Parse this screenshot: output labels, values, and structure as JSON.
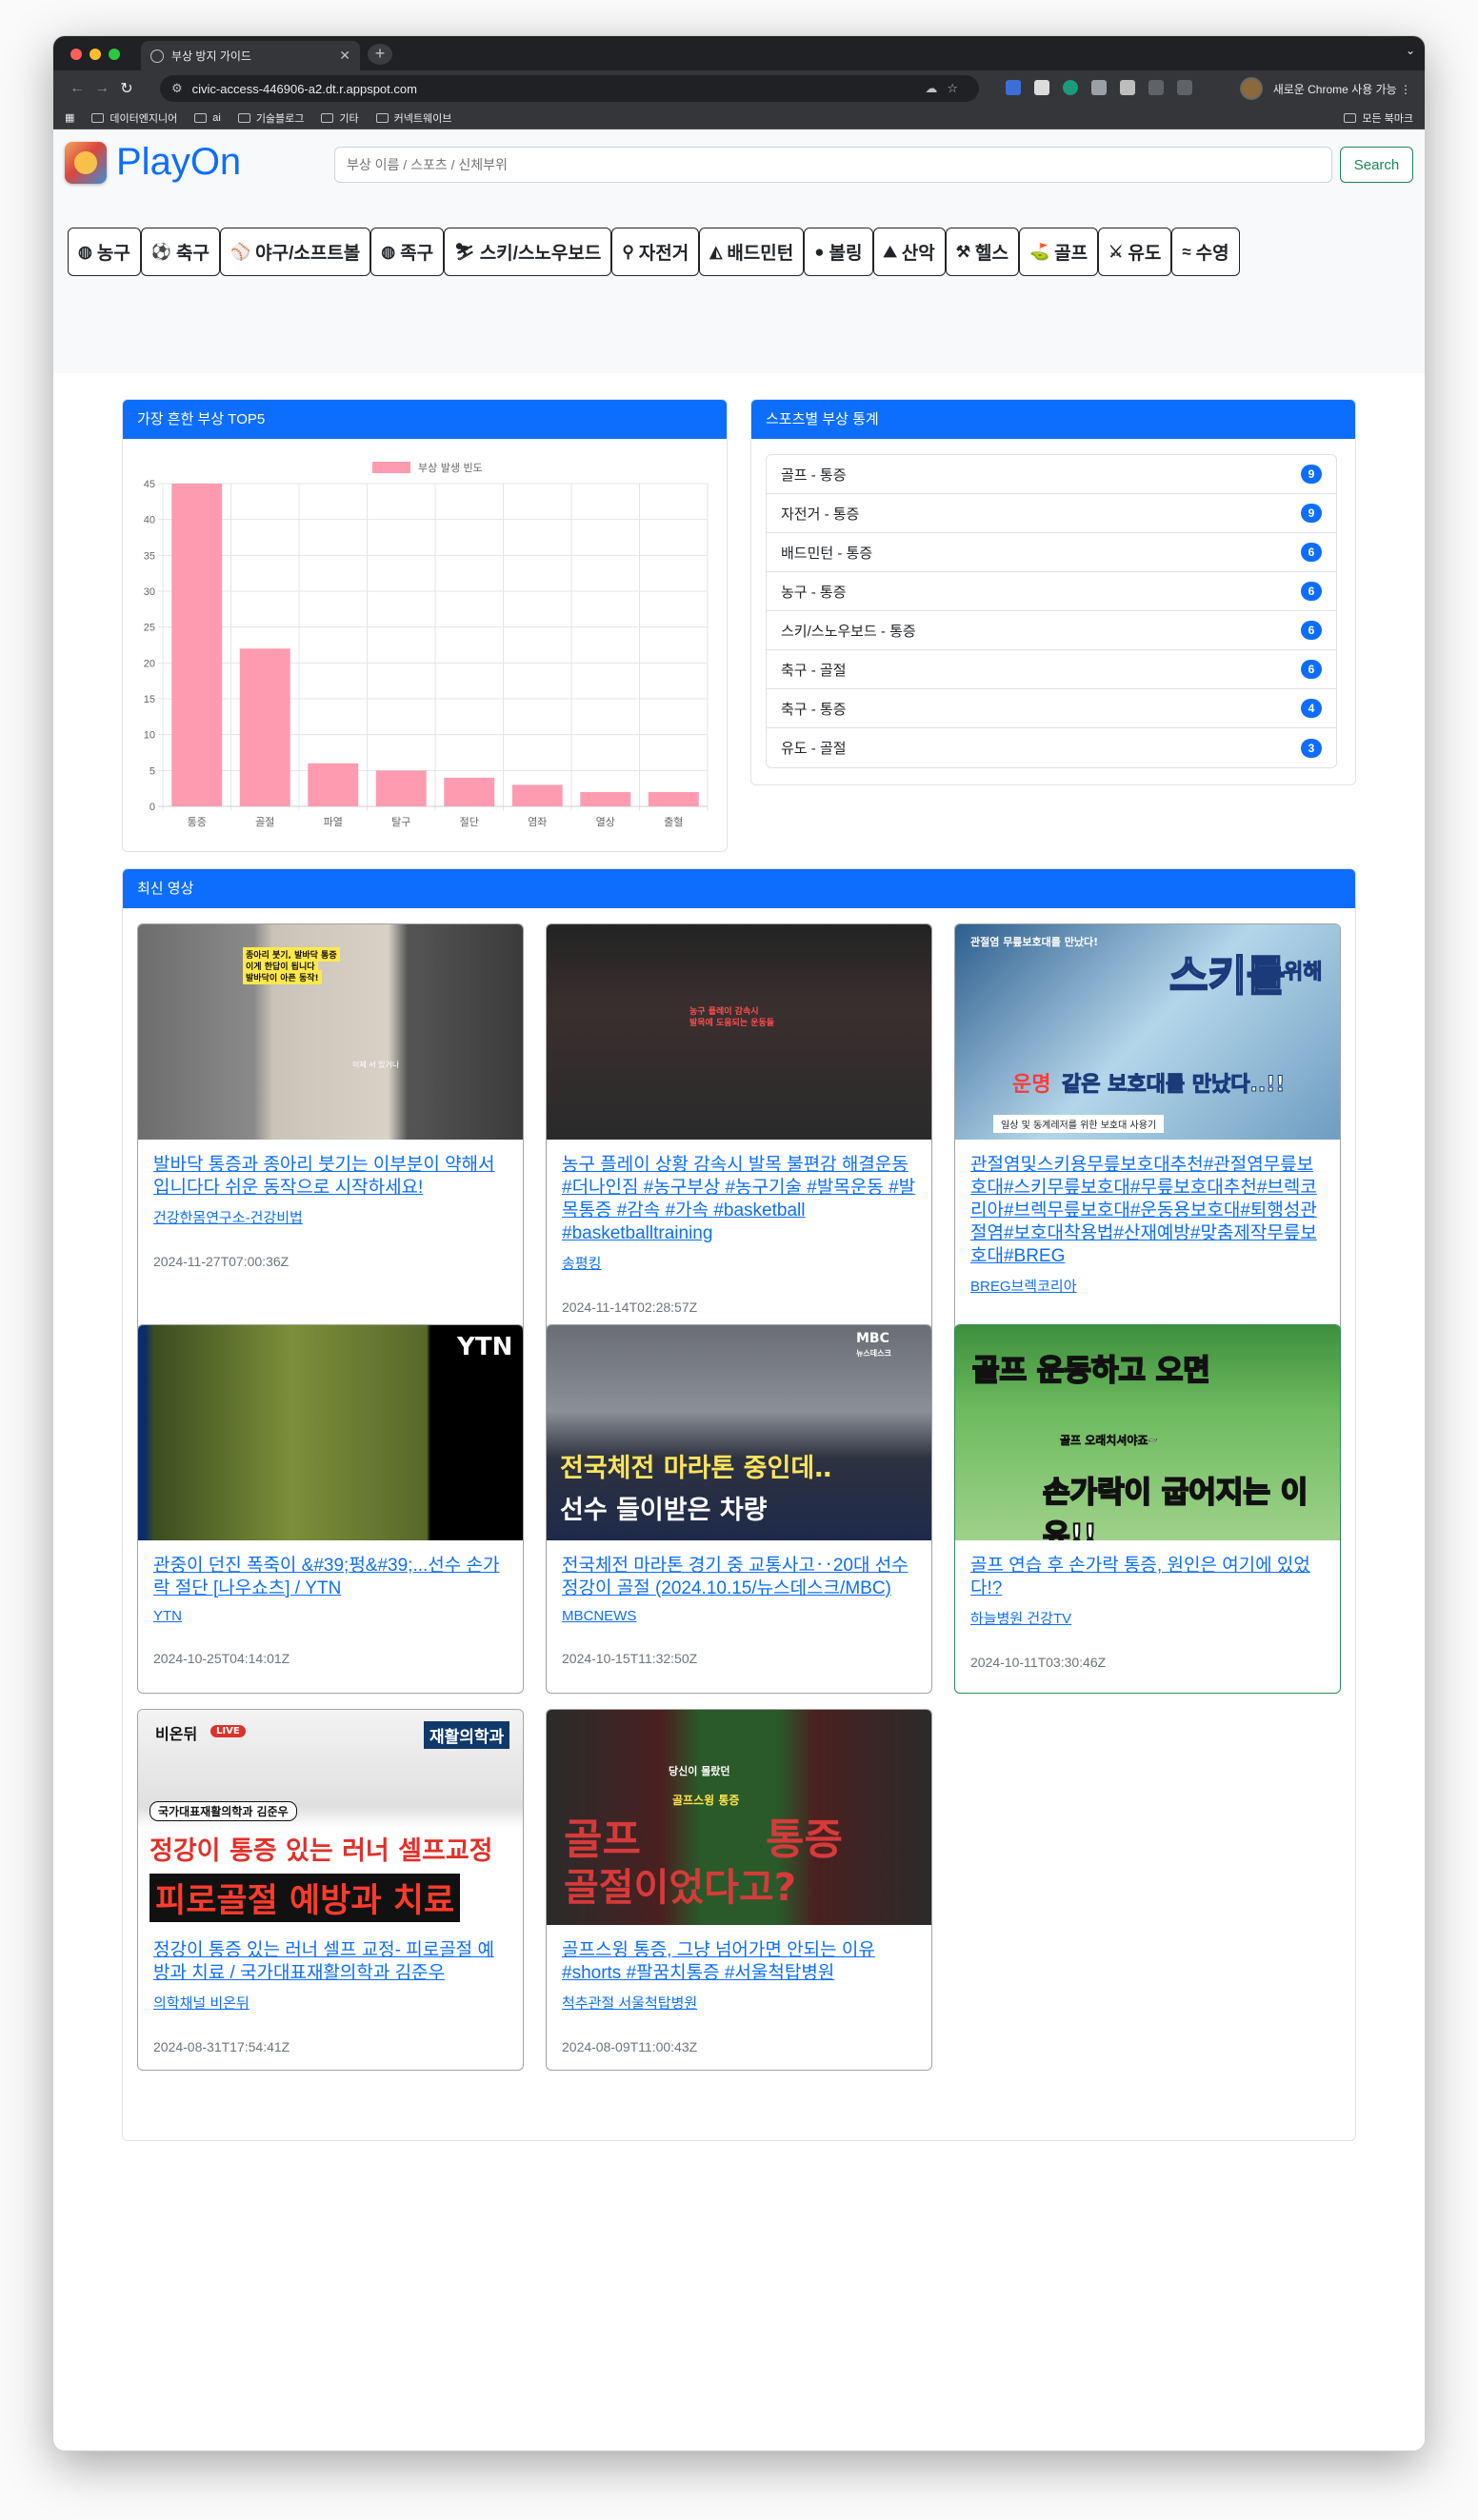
{
  "browser": {
    "tab_title": "부상 방지 가이드",
    "url": "civic-access-446906-a2.dt.r.appspot.com",
    "profile_label": "새로운 Chrome 사용 가능",
    "bookmarks": [
      "데이터엔지니어",
      "ai",
      "기술블로그",
      "기타",
      "커넥트웨이브"
    ],
    "bookmarks_right": "모든 북마크"
  },
  "header": {
    "logo_text": "PlayOn",
    "search_placeholder": "부상 이름 / 스포츠 / 신체부위",
    "search_button": "Search"
  },
  "sports": [
    {
      "icon": "basketball-icon",
      "glyph": "◍",
      "label": "농구"
    },
    {
      "icon": "soccer-icon",
      "glyph": "⚽",
      "label": "축구"
    },
    {
      "icon": "baseball-bat-icon",
      "glyph": "⚾",
      "label": "야구/소프트볼"
    },
    {
      "icon": "volleyball-icon",
      "glyph": "◍",
      "label": "족구"
    },
    {
      "icon": "skier-icon",
      "glyph": "⛷",
      "label": "스키/스노우보드"
    },
    {
      "icon": "bicycle-icon",
      "glyph": "⚲",
      "label": "자전거"
    },
    {
      "icon": "shuttlecock-icon",
      "glyph": "◭",
      "label": "배드민턴"
    },
    {
      "icon": "bowling-ball-icon",
      "glyph": "●",
      "label": "볼링"
    },
    {
      "icon": "hiking-icon",
      "glyph": "⛰",
      "label": "산악"
    },
    {
      "icon": "dumbbell-icon",
      "glyph": "⚒",
      "label": "헬스"
    },
    {
      "icon": "golf-icon",
      "glyph": "⛳",
      "label": "골프"
    },
    {
      "icon": "judo-icon",
      "glyph": "⚔",
      "label": "유도"
    },
    {
      "icon": "swimmer-icon",
      "glyph": "≈",
      "label": "수영"
    }
  ],
  "top5": {
    "header": "가장 흔한 부상 TOP5"
  },
  "chart_data": {
    "type": "bar",
    "categories": [
      "통증",
      "골절",
      "파열",
      "탈구",
      "절단",
      "염좌",
      "열상",
      "출혈"
    ],
    "series": [
      {
        "name": "부상 발생 빈도",
        "values": [
          45,
          22,
          6,
          5,
          4,
          3,
          2,
          2
        ],
        "color": "#ff9bb0"
      }
    ],
    "yticks": [
      0,
      5,
      10,
      15,
      20,
      25,
      30,
      35,
      40,
      45
    ],
    "ylim": [
      0,
      45
    ],
    "legend": "top-center",
    "grid": true
  },
  "stats": {
    "header": "스포츠별 부상 통계",
    "items": [
      {
        "label": "골프 - 통증",
        "count": "9"
      },
      {
        "label": "자전거 - 통증",
        "count": "9"
      },
      {
        "label": "배드민턴 - 통증",
        "count": "6"
      },
      {
        "label": "농구 - 통증",
        "count": "6"
      },
      {
        "label": "스키/스노우보드 - 통증",
        "count": "6"
      },
      {
        "label": "축구 - 골절",
        "count": "6"
      },
      {
        "label": "축구 - 통증",
        "count": "4"
      },
      {
        "label": "유도 - 골절",
        "count": "3"
      }
    ]
  },
  "videos": {
    "header": "최신 영상",
    "items": [
      {
        "title": "발바닥 통증과 종아리 붓기는 이부분이 약해서 입니다다 쉬운 동작으로 시작하세요!",
        "channel": "건강한몸연구소-건강비법",
        "date": "2024-11-27T07:00:36Z",
        "thumb_text": [
          "종아리 붓기, 발바닥 통증",
          "이게 한답이 됩니다",
          "발바닥이 아픈 동작!",
          "이제 서 있거나"
        ]
      },
      {
        "title": "농구 플레이 상황 감속시 발목 불편감 해결운동 #더나인짐 #농구부상 #농구기술 #발목운동 #발목통증 #감속 #가속 #basketball #basketballtraining",
        "channel": "송평킹",
        "date": "2024-11-14T02:28:57Z",
        "thumb_text": [
          "농구 플레이 감속시",
          "발목에 도움되는 운동들"
        ]
      },
      {
        "title": "관절염및스키용무릎보호대추천#관절염무릎보호대#스키무릎보호대#무릎보호대추천#브렉코리아#브렉무릎보호대#운동용보호대#퇴행성관절염#보호대착용법#산재예방#맞춤제작무릎보호대#BREG",
        "channel": "BREG브렉코리아",
        "date": "2024-10-26T06:01:24Z",
        "thumb_text": [
          "관절염 무릎보호대를 만났다!",
          "스키를",
          "위해",
          "운명",
          "같은 보호대를 만났다..!!",
          "일상 및 동계레저를 위한 보호대 사용기"
        ]
      },
      {
        "title": "관중이 던진 폭죽이 &#39;펑&#39;...선수 손가락 절단 [나우쇼츠] / YTN",
        "channel": "YTN",
        "date": "2024-10-25T04:14:01Z",
        "thumb_text": [
          "YTN"
        ]
      },
      {
        "title": "전국체전 마라톤 경기 중 교통사고‥20대 선수 정강이 골절 (2024.10.15/뉴스데스크/MBC)",
        "channel": "MBCNEWS",
        "date": "2024-10-15T11:32:50Z",
        "thumb_text": [
          "MBC",
          "뉴스데스크",
          "전국체전 마라톤 중인데‥",
          "선수 들이받은 차량"
        ]
      },
      {
        "title": "골프 연습 후 손가락 통증, 원인은 여기에 있었다!?",
        "channel": "하늘병원 건강TV",
        "date": "2024-10-11T03:30:46Z",
        "thumb_text": [
          "골프 운동하고 오면",
          "골프 오래치셔야죠~",
          "손가락이 굽어지는 이유!!"
        ]
      },
      {
        "title": "정강이 통증 있는 러너 셀프 교정- 피로골절 예방과 치료 / 국가대표재활의학과 김준우",
        "channel": "의학채널 비온뒤",
        "date": "2024-08-31T17:54:41Z",
        "thumb_text": [
          "비온뒤",
          "LIVE",
          "재활의학과",
          "국가대표재활의학과 김준우",
          "정강이 통증 있는 러너 셀프교정",
          "피로골절 예방과 치료"
        ]
      },
      {
        "title": "골프스윙 통증, 그냥 넘어가면 안되는 이유 #shorts #팔꿈치통증 #서울척탑병원",
        "channel": "척추관절 서울척탑병원",
        "date": "2024-08-09T11:00:43Z",
        "thumb_text": [
          "당신이 몰랐던",
          "골프",
          "통증",
          "골프스윙 통증",
          "골절이었다고?"
        ]
      }
    ]
  }
}
